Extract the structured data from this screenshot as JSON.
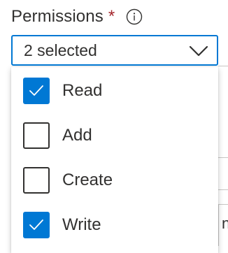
{
  "field": {
    "label": "Permissions",
    "required_mark": "*",
    "info_icon": "info-icon"
  },
  "dropdown": {
    "value": "2 selected",
    "chevron_icon": "chevron-down-icon",
    "accent_color": "#0078d4"
  },
  "options": [
    {
      "label": "Read",
      "checked": true
    },
    {
      "label": "Add",
      "checked": false
    },
    {
      "label": "Create",
      "checked": false
    },
    {
      "label": "Write",
      "checked": true
    }
  ],
  "background": {
    "partial_text": "nl"
  },
  "colors": {
    "accent": "#0078d4",
    "required": "#a4262c",
    "text": "#323130"
  }
}
